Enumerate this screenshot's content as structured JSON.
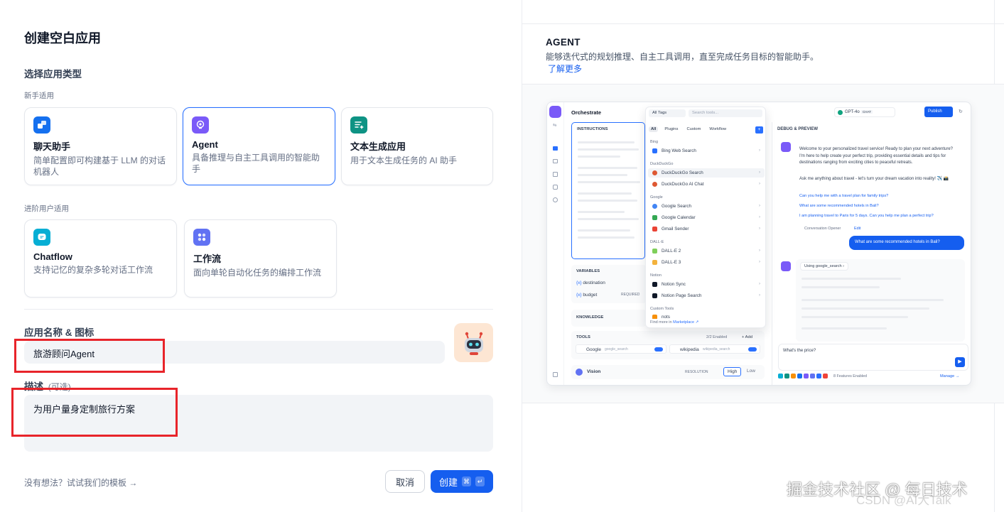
{
  "page_title": "创建空白应用",
  "type_section": {
    "title": "选择应用类型",
    "beginner_label": "新手适用",
    "advanced_label": "进阶用户适用",
    "cards": [
      {
        "name": "聊天助手",
        "desc": "简单配置即可构建基于 LLM 的对话机器人",
        "color": "#1570ef"
      },
      {
        "name": "Agent",
        "desc": "具备推理与自主工具调用的智能助手",
        "color": "#7a5af8",
        "selected": true
      },
      {
        "name": "文本生成应用",
        "desc": "用于文本生成任务的 AI 助手",
        "color": "#0e9384"
      },
      {
        "name": "Chatflow",
        "desc": "支持记忆的复杂多轮对话工作流",
        "color": "#06aed4"
      },
      {
        "name": "工作流",
        "desc": "面向单轮自动化任务的编排工作流",
        "color": "#6172f3"
      }
    ]
  },
  "name_section": {
    "label": "应用名称 & 图标",
    "value": "旅游顾问Agent"
  },
  "desc_section": {
    "label": "描述",
    "optional": "(可选)",
    "value": "为用户量身定制旅行方案"
  },
  "footer": {
    "template_link": "没有想法？试试我们的模板 →",
    "cancel": "取消",
    "create": "创建",
    "kbd1": "⌘",
    "kbd2": "↵"
  },
  "preview": {
    "title": "AGENT",
    "desc": "能够迭代式的规划推理、自主工具调用，直至完成任务目标的智能助手。",
    "learn_more": "了解更多",
    "mini": {
      "orchestrate": "Orchestrate",
      "instructions": "INSTRUCTIONS",
      "variables": "VARIABLES",
      "var1": "destination",
      "var2": "budget",
      "required": "REQUIRED",
      "knowledge": "KNOWLEDGE",
      "tools": "TOOLS",
      "tools_enabled": "2/2 Enabled",
      "add": "+ Add",
      "tool1": "Google",
      "tool1_id": "google_search",
      "tool2": "wikipedia",
      "tool2_id": "wikipedia_search",
      "vision": "Vision",
      "resolution": "RESOLUTION",
      "high": "High",
      "low": "Low",
      "all_tags": "All Tags",
      "search_tools": "Search tools...",
      "filter_tabs": [
        "All",
        "Plugins",
        "Custom",
        "Workflow"
      ],
      "groups": [
        {
          "name": "Bing",
          "items": [
            "Bing Web Search"
          ]
        },
        {
          "name": "DuckDuckGo",
          "items": [
            "DuckDuckGo Search",
            "DuckDuckGo AI Chat"
          ]
        },
        {
          "name": "Google",
          "items": [
            "Google Search",
            "Google Calendar",
            "Gmail Sender"
          ]
        },
        {
          "name": "DALL-E",
          "items": [
            "DALL-E 2",
            "DALL-E 3"
          ]
        },
        {
          "name": "Notion",
          "items": [
            "Notion Sync",
            "Notion Page Search"
          ]
        },
        {
          "name": "Custom Tools",
          "items": [
            "nots"
          ]
        }
      ],
      "find_more": "Find more in",
      "marketplace": "Marketplace ↗",
      "model": "GPT-4o",
      "chat_badge": "CHAT",
      "publish": "Publish",
      "debug": "DEBUG & PREVIEW",
      "welcome": "Welcome to your personalized travel service! Ready to plan your next adventure? I'm here to help create your perfect trip, providing essential details and tips for destinations ranging from exciting cities to peaceful retreats.",
      "ask": "Ask me anything about travel - let's turn your dream vacation into reality! ✈️ 📸",
      "suggest1": "Can you help me with a travel plan for family trips?",
      "suggest2": "What are some recommended hotels in Bali?",
      "suggest3": "I am planning travel to Paris for 5 days. Can you help me plan a perfect trip?",
      "opener": "Conversation Opener",
      "edit": "Edit",
      "user_msg": "What are some recommended hotels in Bali?",
      "using": "Using",
      "using_tool": "google_search",
      "input": "What's the price?",
      "features": "8 Features Enabled",
      "manage": "Manage →"
    }
  },
  "watermark": "掘金技术社区 @ 每日技术",
  "watermark_bg": "CSDN @AI大Talk"
}
